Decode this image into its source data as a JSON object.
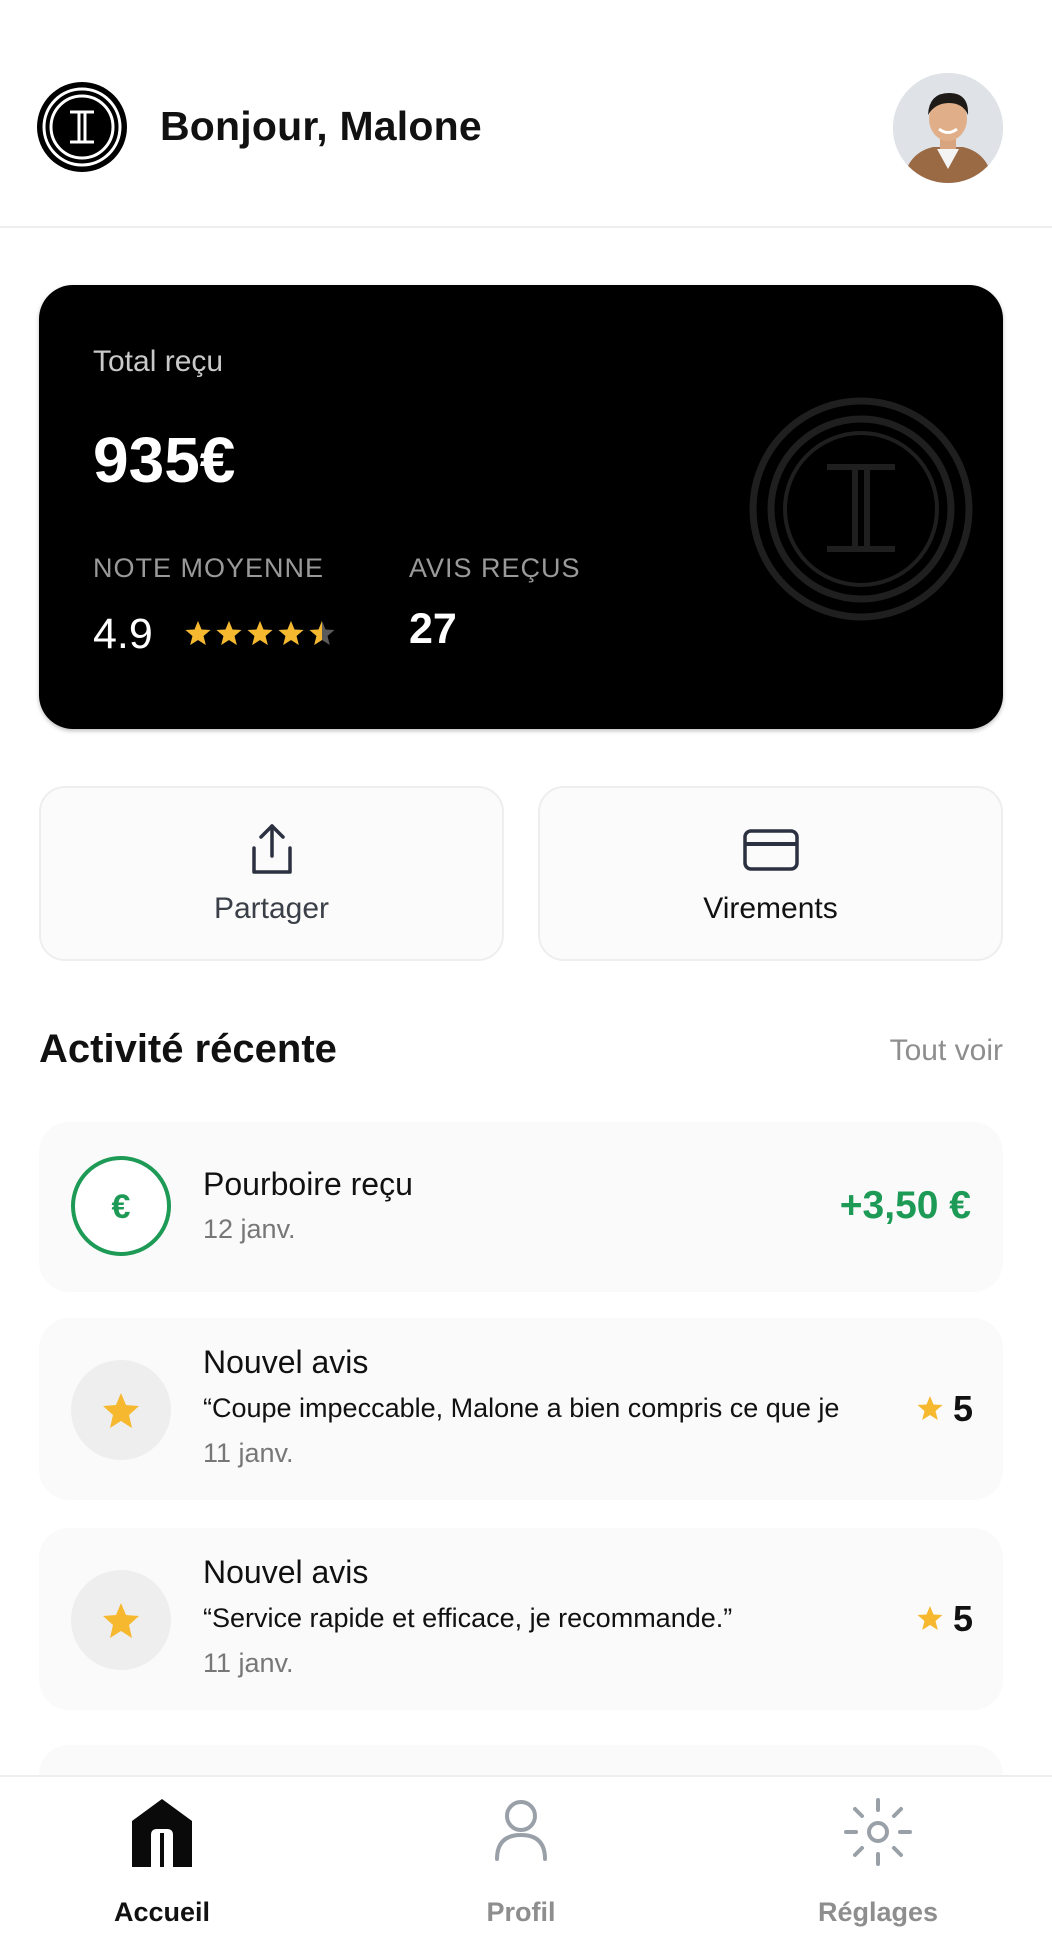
{
  "header": {
    "greeting": "Bonjour, Malone",
    "logo_icon": "brand-logo-icon",
    "avatar_icon": "avatar"
  },
  "balance_card": {
    "label": "Total reçu",
    "amount": "935€",
    "rating_label": "NOTE MOYENNE",
    "rating_value": "4.9",
    "rating_stars": 4.5,
    "reviews_label": "AVIS REÇUS",
    "reviews_count": "27"
  },
  "actions": [
    {
      "label": "Partager",
      "icon": "share-icon"
    },
    {
      "label": "Virements",
      "icon": "card-icon"
    }
  ],
  "activity": {
    "title": "Activité récente",
    "see_all": "Tout voir",
    "items": [
      {
        "title": "Pourboire reçu",
        "date": "12 janv.",
        "amount": "+3,50 €",
        "icon": "euro-icon"
      },
      {
        "title": "Nouvel avis",
        "quote": "“Coupe impeccable, Malone a bien compris ce que je",
        "date": "11 janv.",
        "rating": "5",
        "icon": "star-icon"
      },
      {
        "title": "Nouvel avis",
        "quote": "“Service rapide et efficace, je recommande.”",
        "date": "11 janv.",
        "rating": "5",
        "icon": "star-icon"
      }
    ]
  },
  "nav": {
    "items": [
      {
        "label": "Accueil",
        "icon": "home-icon",
        "active": true
      },
      {
        "label": "Profil",
        "icon": "user-icon",
        "active": false
      },
      {
        "label": "Réglages",
        "icon": "settings-icon",
        "active": false
      }
    ]
  },
  "colors": {
    "accent_green": "#1d9a55",
    "star_yellow": "#f5b82e",
    "card_bg": "#000000",
    "muted": "#8e8e8e"
  }
}
